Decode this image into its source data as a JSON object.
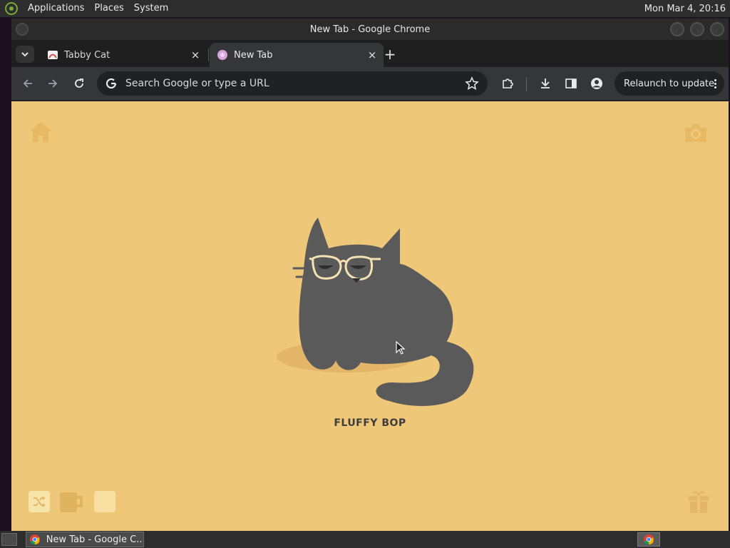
{
  "top_panel": {
    "menus": [
      "Applications",
      "Places",
      "System"
    ],
    "clock": "Mon Mar  4, 20:16"
  },
  "window": {
    "title": "New Tab - Google Chrome"
  },
  "tabs": [
    {
      "label": "Tabby Cat",
      "active": false,
      "close": "×"
    },
    {
      "label": "New Tab",
      "active": true,
      "close": "×"
    }
  ],
  "new_tab_symbol": "+",
  "toolbar": {
    "omnibox_placeholder": "Search Google or type a URL",
    "relaunch_label": "Relaunch to update"
  },
  "page": {
    "cat_name": "FLUFFY BOP",
    "background_color": "#efc778",
    "cat_color": "#5a5a5a"
  },
  "taskbar": {
    "task_label": "New Tab - Google C..."
  },
  "icons": [
    "search-tabs-icon",
    "back-arrow-icon",
    "forward-arrow-icon",
    "reload-icon",
    "google-g-icon",
    "bookmark-star-icon",
    "extensions-icon",
    "downloads-icon",
    "side-panel-icon",
    "profile-icon",
    "more-menu-icon",
    "home-icon",
    "camera-icon",
    "shuffle-icon",
    "mug-icon",
    "gift-icon"
  ]
}
